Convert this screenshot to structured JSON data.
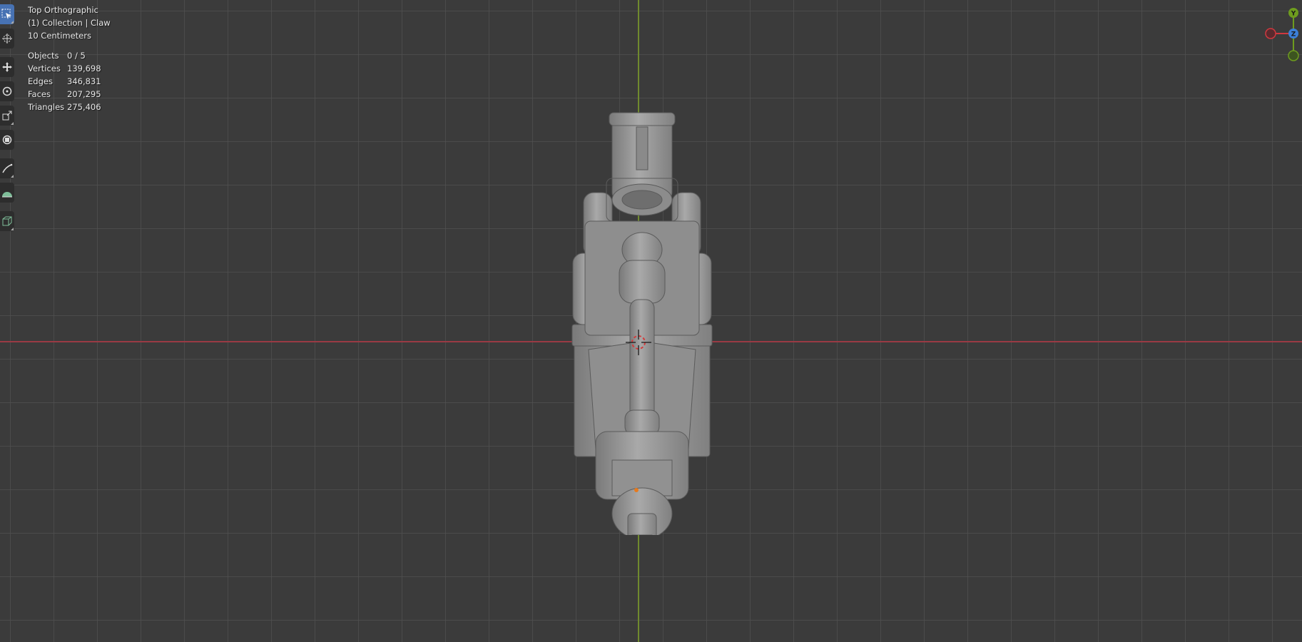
{
  "viewport": {
    "view_name": "Top Orthographic",
    "collection": "(1) Collection | Claw",
    "scale": "10 Centimeters"
  },
  "stats": [
    {
      "label": "Objects",
      "value": "0 / 5"
    },
    {
      "label": "Vertices",
      "value": "139,698"
    },
    {
      "label": "Edges",
      "value": "346,831"
    },
    {
      "label": "Faces",
      "value": "207,295"
    },
    {
      "label": "Triangles",
      "value": "275,406"
    }
  ],
  "toolbar": {
    "tools": [
      {
        "name": "select-box",
        "icon": "select-box-icon",
        "active": true
      },
      {
        "name": "cursor",
        "icon": "cursor-icon",
        "active": false
      },
      {
        "name": "move",
        "icon": "move-icon",
        "active": false
      },
      {
        "name": "rotate",
        "icon": "rotate-icon",
        "active": false
      },
      {
        "name": "scale",
        "icon": "scale-icon",
        "active": false
      },
      {
        "name": "transform",
        "icon": "transform-icon",
        "active": false
      },
      {
        "name": "annotate",
        "icon": "annotate-icon",
        "active": false
      },
      {
        "name": "measure",
        "icon": "measure-icon",
        "active": false
      },
      {
        "name": "add-cube",
        "icon": "add-cube-icon",
        "active": false
      }
    ]
  },
  "gizmo": {
    "y_label": "Y",
    "z_label": "Z",
    "colors": {
      "x": "#d0383f",
      "y": "#6e9c1e",
      "z": "#3c7fd8"
    }
  },
  "colors": {
    "background": "#3b3b3b",
    "grid": "#505050",
    "x_axis": "#9a3a44",
    "y_axis": "#6f8a2e",
    "active_tool": "#4772b3",
    "model": "#9c9c9c"
  }
}
